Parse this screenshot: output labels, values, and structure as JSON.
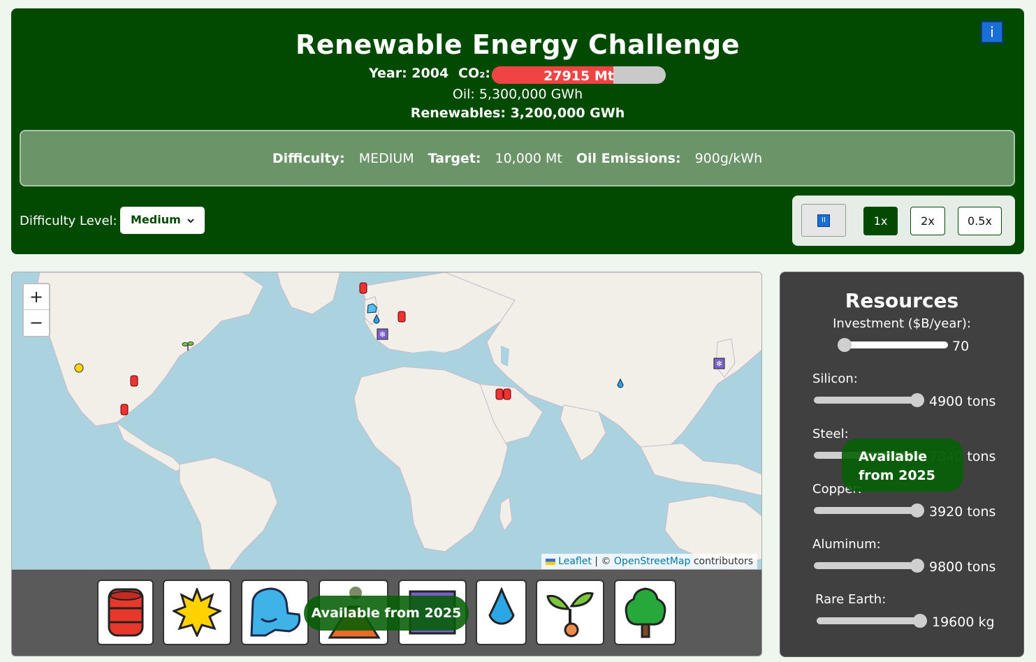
{
  "header": {
    "title": "Renewable Energy Challenge",
    "info_icon": "i",
    "year_text": "Year: 2004",
    "co2_label": "CO₂:",
    "co2_value": "27915 Mt",
    "co2_fill_fraction": 0.7,
    "oil_text": "Oil: 5,300,000 GWh",
    "renewables_text": "Renewables: 3,200,000 GWh"
  },
  "info_strip": {
    "difficulty_label": "Difficulty:",
    "difficulty_value": "MEDIUM",
    "target_label": "Target:",
    "target_value": "10,000 Mt",
    "emissions_label": "Oil Emissions:",
    "emissions_value": "900g/kWh"
  },
  "controls": {
    "difficulty_level_label": "Difficulty Level:",
    "difficulty_selected": "Medium",
    "pause_icon": "II",
    "speeds": [
      "1x",
      "2x",
      "0.5x"
    ],
    "active_speed": "1x"
  },
  "map": {
    "zoom_in": "+",
    "zoom_out": "−",
    "attribution_leaflet": "Leaflet",
    "attribution_sep": " | © ",
    "attribution_osm": "OpenStreetMap",
    "attribution_tail": " contributors",
    "marker_types": [
      "oil-barrel-icon",
      "sun-icon",
      "wind-face-icon",
      "water-drop-icon",
      "sprout-icon",
      "snowflake-icon"
    ]
  },
  "tray": {
    "tiles": [
      "oil-barrel-icon",
      "sun-icon",
      "wind-face-icon",
      "volcano-icon",
      "frame-icon",
      "water-drop-icon",
      "sprout-icon",
      "tree-icon"
    ],
    "available_notice": "Available from 2025"
  },
  "resources": {
    "title": "Resources",
    "investment_label": "Investment ($B/year):",
    "investment_value": "70",
    "silicon_label": "Silicon:",
    "silicon_value": "4900 tons",
    "steel_label": "Steel:",
    "steel_value_number": "7840",
    "steel_value_unit": "tons",
    "copper_label": "Copper:",
    "copper_value": "3920 tons",
    "aluminum_label": "Aluminum:",
    "aluminum_value": "9800 tons",
    "rare_earth_label": "Rare Earth:",
    "rare_earth_value": "19600 kg",
    "available_line1": "Available",
    "available_line2": "from 2025"
  }
}
